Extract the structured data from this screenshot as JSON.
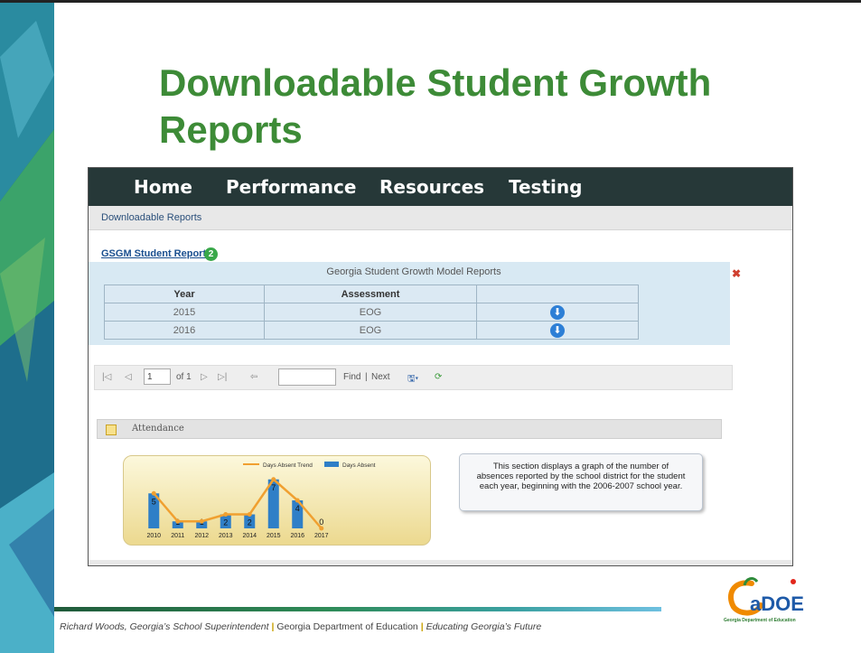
{
  "slide": {
    "title": "Downloadable Student Growth Reports"
  },
  "nav": {
    "items": [
      "Home",
      "Performance",
      "Resources",
      "Testing"
    ]
  },
  "breadcrumb": "Downloadable Reports",
  "gsgm": {
    "link_label": "GSGM Student Report",
    "badge_count": "2",
    "panel_title": "Georgia Student Growth Model Reports",
    "close_icon": "close-x-icon",
    "columns": [
      "Year",
      "Assessment",
      ""
    ],
    "rows": [
      {
        "year": "2015",
        "assessment": "EOG"
      },
      {
        "year": "2016",
        "assessment": "EOG"
      }
    ]
  },
  "toolbar": {
    "page_value": "1",
    "of_label": "of 1",
    "find_label": "Find",
    "separator": "|",
    "next_label": "Next"
  },
  "attendance": {
    "header_label": "Attendance",
    "note": "This section displays a graph of the number of absences reported by the school district for the student each year, beginning with the 2006-2007 school year."
  },
  "chart_data": {
    "type": "bar",
    "categories": [
      "2010",
      "2011",
      "2012",
      "2013",
      "2014",
      "2015",
      "2016",
      "2017"
    ],
    "series": [
      {
        "name": "Days Absent",
        "type": "bar",
        "values": [
          5,
          1,
          1,
          2,
          2,
          7,
          4,
          0
        ],
        "color": "#2f7fc7"
      },
      {
        "name": "Days Absent Trend",
        "type": "line",
        "values": [
          5,
          1,
          1,
          2,
          2,
          7,
          4,
          0
        ],
        "color": "#f0a030"
      }
    ],
    "data_labels": [
      "5",
      "1",
      "1",
      "2",
      "2",
      "7",
      "4",
      "0"
    ],
    "ylim": [
      0,
      8
    ],
    "legend": "top",
    "grid": false
  },
  "footer": {
    "superintendent": "Richard Woods, Georgia’s School Superintendent",
    "sep1": "|",
    "department": "Georgia Department of Education",
    "sep2": "|",
    "tagline": "Educating Georgia’s Future"
  },
  "logo": {
    "text": "GaDOE",
    "subtext": "Georgia Department of Education"
  },
  "colors": {
    "title_green": "#3d8b37",
    "nav_bg": "#263838",
    "panel_blue": "#d8e9f3",
    "bar_blue": "#2f7fc7",
    "trend_orange": "#f0a030"
  }
}
